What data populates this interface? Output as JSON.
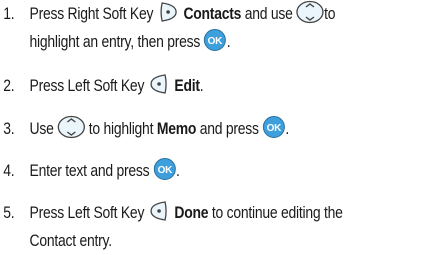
{
  "steps": [
    {
      "number": "1.",
      "lines": [
        [
          "Press Right Soft Key ",
          "[right-soft-key-icon]",
          " ",
          "**Contacts**",
          " and use ",
          "[nav-key-icon]",
          "to"
        ],
        [
          "highlight an entry, then press ",
          "[ok-key-icon]",
          "."
        ]
      ]
    },
    {
      "number": "2.",
      "parts": [
        "Press Left Soft Key ",
        "Edit",
        "."
      ]
    },
    {
      "number": "3.",
      "parts": [
        "Use ",
        " to highlight ",
        "Memo",
        " and press ",
        "."
      ]
    },
    {
      "number": "4.",
      "parts": [
        "Enter text and press ",
        "."
      ]
    },
    {
      "number": "5.",
      "parts": [
        "Press Left Soft Key ",
        "Done",
        " to continue editing the"
      ],
      "continuation": "Contact entry."
    }
  ],
  "step1": {
    "number": "1.",
    "a": "Press Right Soft Key ",
    "b": "Contacts",
    "c": " and use ",
    "d": "to",
    "e": "highlight an entry, then press ",
    "f": "."
  },
  "icons": {
    "right_soft_key": "right-soft-key-icon",
    "left_soft_key": "left-soft-key-icon",
    "nav_key": "nav-key-icon",
    "ok_key": "ok-key-icon",
    "ok_label": "OK"
  },
  "colors": {
    "icon_fill": "#6fc2ee",
    "icon_stroke": "#444444",
    "ok_fill": "#3d9fdc"
  }
}
